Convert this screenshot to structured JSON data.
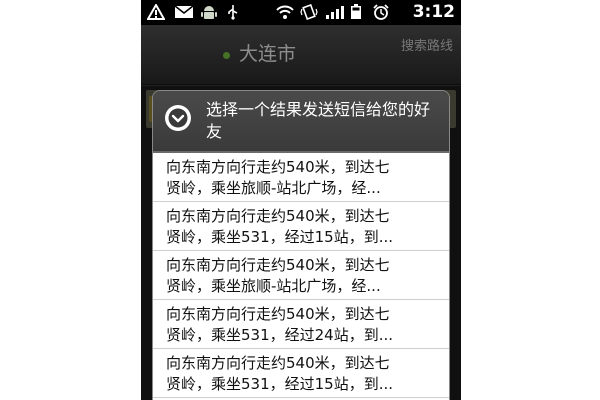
{
  "status_bar": {
    "time": "3:12",
    "icons": [
      "warning-icon",
      "envelope-icon",
      "android-icon",
      "usb-icon",
      "wifi-icon",
      "vibrate-icon",
      "signal-icon",
      "battery-icon",
      "alarm-icon"
    ]
  },
  "header": {
    "city": "大连市",
    "search_route": "搜索路线"
  },
  "dialog": {
    "title": "选择一个结果发送短信给您的好友",
    "items": [
      {
        "line1": "向东南方向行走约540米，到达七",
        "line2": "贤岭，乘坐旅顺-站北广场，经..."
      },
      {
        "line1": "向东南方向行走约540米，到达七",
        "line2": "贤岭，乘坐531，经过15站，到..."
      },
      {
        "line1": "向东南方向行走约540米，到达七",
        "line2": "贤岭，乘坐旅顺-站北广场，经..."
      },
      {
        "line1": "向东南方向行走约540米，到达七",
        "line2": "贤岭，乘坐531，经过24站，到..."
      },
      {
        "line1": "向东南方向行走约540米，到达七",
        "line2": "贤岭，乘坐531，经过15站，到..."
      }
    ]
  },
  "colors": {
    "status_bar": "#000000",
    "city_dot": "#7fcf45",
    "dialog_header": "#3a3a3a",
    "list_background": "#ffffff"
  }
}
